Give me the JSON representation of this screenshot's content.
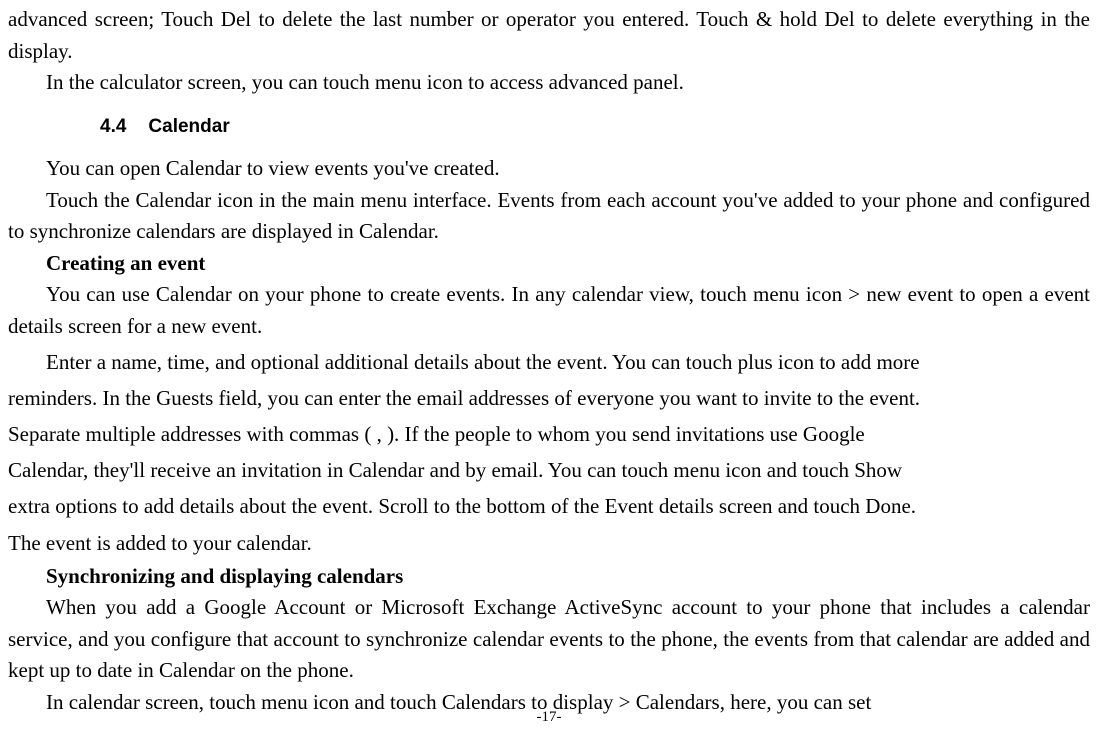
{
  "p1": "advanced screen; Touch Del to delete the last number or operator you entered. Touch & hold Del to delete everything in the display.",
  "p2": "In the calculator screen, you can touch menu icon to access advanced panel.",
  "section_num": "4.4",
  "section_title": "Calendar",
  "p3": "You can open Calendar to view events you've created.",
  "p4": "Touch the Calendar icon in the main menu interface. Events from each account you've added to your phone and configured to synchronize calendars are displayed in Calendar.",
  "sub1": "Creating an event",
  "p5": "You can use Calendar on your phone to create events. In any calendar view, touch menu icon > new event to open a event details screen for a new event.",
  "p6a": "Enter a name, time, and optional additional details about the event. You can touch plus icon to add more",
  "p6b": "reminders. In the Guests field, you can enter the email addresses of everyone you want to invite to the event.",
  "p6c": "Separate multiple addresses with commas ( , ). If the people to whom you send invitations use Google",
  "p6d": "Calendar, they'll receive an invitation in Calendar and by email. You can touch menu icon and touch Show",
  "p6e": "extra options to add details about the event. Scroll to the bottom of the Event details screen and touch Done.",
  "p6f": "The event is added to your calendar.",
  "sub2": "Synchronizing and displaying calendars",
  "p7": "When you add a Google Account or Microsoft Exchange ActiveSync account to your phone that includes a calendar service, and you configure that account to synchronize calendar events to the phone, the events from that calendar are added and kept up to date in Calendar on the phone.",
  "p8": "In calendar screen, touch menu icon and touch Calendars to display > Calendars, here, you can set",
  "page_number": "-17-"
}
